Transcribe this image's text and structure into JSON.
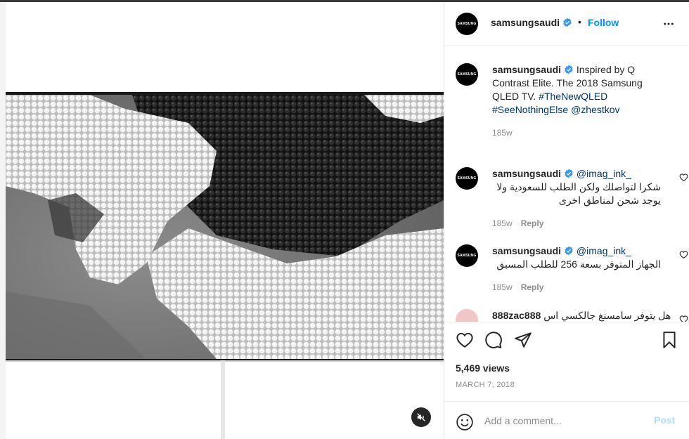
{
  "post": {
    "username": "samsungsaudi",
    "follow_label": "Follow",
    "separator": "•",
    "avatar_text": "SAMSUNG"
  },
  "caption": {
    "username": "samsungsaudi",
    "text": "Inspired by Q Contrast Elite. The 2018 Samsung QLED TV.",
    "hashtags": "#TheNewQLED #SeeNothingElse",
    "mention": "@zhestkov",
    "age": "185w"
  },
  "comments": [
    {
      "username": "samsungsaudi",
      "mention": "@imag_ink_",
      "text": "شكرا لتواصلك ولكن الطلب للسعودية ولا يوجد شحن لمناطق اخرى",
      "age": "185w",
      "reply_label": "Reply"
    },
    {
      "username": "samsungsaudi",
      "mention": "@imag_ink_",
      "text": "الجهاز المتوفر بسعة 256 للطلب المسبق",
      "age": "185w",
      "reply_label": "Reply"
    },
    {
      "username": "888zac888",
      "text": "هل يتوفر سامسنغ جالكسي اس"
    }
  ],
  "stats": {
    "views": "5,469 views",
    "date": "MARCH 7, 2018"
  },
  "add_comment": {
    "placeholder": "Add a comment...",
    "post_label": "Post"
  },
  "colors": {
    "accent": "#0095f6",
    "verified": "#3897f0",
    "hashtag": "#00376b",
    "muted": "#8e8e8e",
    "post_disabled": "#b2dffc"
  },
  "icons": {
    "verified": "verified-badge-icon",
    "more": "more-options-icon",
    "like": "heart-icon",
    "comment": "comment-icon",
    "share": "share-icon",
    "save": "bookmark-icon",
    "emoji": "emoji-icon",
    "mute": "muted-speaker-icon"
  }
}
